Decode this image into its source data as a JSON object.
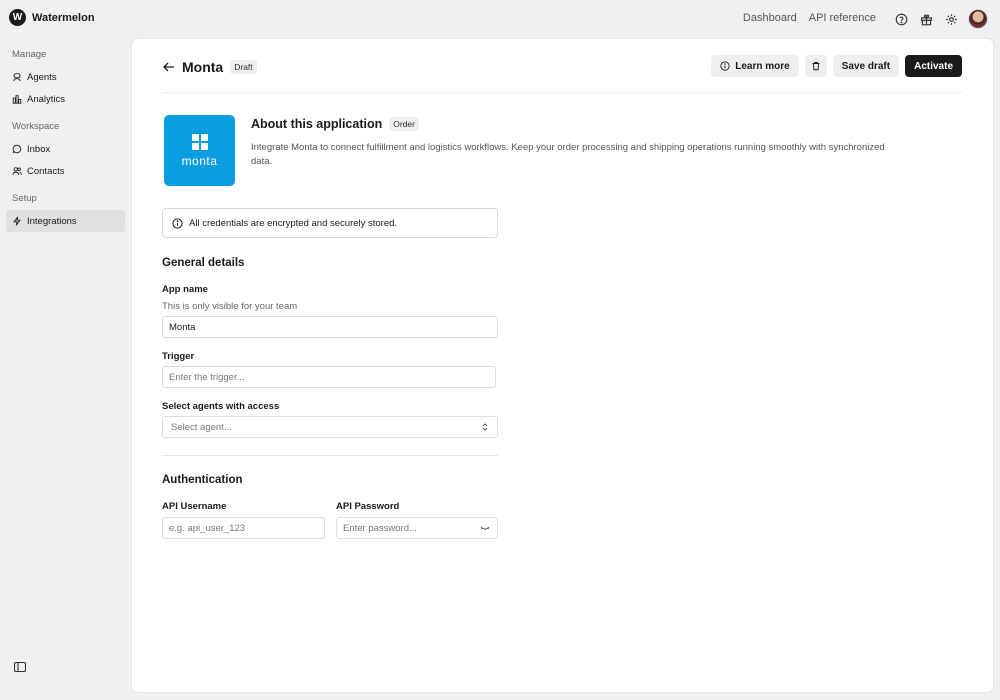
{
  "app": {
    "brand_initial": "W",
    "brand_name": "Watermelon"
  },
  "topnav": {
    "links": [
      "Dashboard",
      "API reference"
    ]
  },
  "sidebar": {
    "sections": [
      {
        "title": "Manage",
        "items": [
          {
            "label": "Agents",
            "icon": "agents-icon"
          },
          {
            "label": "Analytics",
            "icon": "analytics-icon"
          }
        ]
      },
      {
        "title": "Workspace",
        "items": [
          {
            "label": "Inbox",
            "icon": "inbox-icon"
          },
          {
            "label": "Contacts",
            "icon": "contacts-icon"
          }
        ]
      },
      {
        "title": "Setup",
        "items": [
          {
            "label": "Integrations",
            "icon": "integrations-icon",
            "active": true
          }
        ]
      }
    ]
  },
  "header": {
    "title": "Monta",
    "status_badge": "Draft",
    "learn_more": "Learn more",
    "save_draft": "Save draft",
    "activate": "Activate"
  },
  "about": {
    "logo_text": "monta",
    "title": "About this application",
    "category_badge": "Order",
    "description": "Integrate Monta to connect fulfillment and logistics workflows. Keep your order processing and shipping operations running smoothly with synchronized data."
  },
  "notice": {
    "text": "All credentials are encrypted and securely stored."
  },
  "general": {
    "title": "General details",
    "app_name_label": "App name",
    "app_name_helper": "This is only visible for your team",
    "app_name_value": "Monta",
    "trigger_label": "Trigger",
    "trigger_placeholder": "Enter the trigger...",
    "agents_label": "Select agents with access",
    "agents_placeholder": "Select agent..."
  },
  "auth": {
    "title": "Authentication",
    "username_label": "API Username",
    "username_placeholder": "e.g. api_user_123",
    "password_label": "API Password",
    "password_placeholder": "Enter password..."
  },
  "colors": {
    "accent": "#1a1a1a",
    "monta_blue": "#0a9de0",
    "background": "#f0f0f0"
  }
}
